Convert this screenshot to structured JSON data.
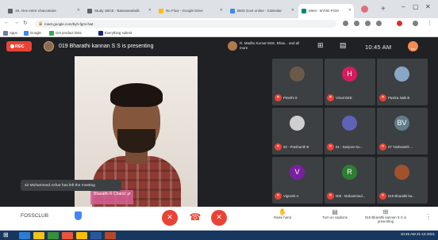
{
  "browser": {
    "tabs": [
      {
        "title": "19, Alex entre chancelaire"
      },
      {
        "title": "Study 1BCE - Basavanahalli"
      },
      {
        "title": "No Flow - Google Drive"
      },
      {
        "title": "BMS Govt online - Calendar"
      },
      {
        "title": "Meet - BYHE-FGM"
      }
    ],
    "address": "meet.google.com/byh-fgmi-hwt",
    "bookmarks": [
      "Apps",
      "Google",
      "Get product hints",
      "Everything submit"
    ]
  },
  "meet": {
    "rec_label": "REC",
    "presenting_text": "019 Bharathi kannan S S is presenting",
    "pinned_text": "R. Madhu Kumar EEE, Bhas... and all more",
    "clock": "10:45 AM",
    "you_label": "You",
    "main_tile_label": "Bharathi R Chand .yr",
    "toast": "42 Mohammed Azhar has left the meeting",
    "participants": [
      {
        "name": "Preethi S",
        "initial": "",
        "color": "#6b5a48"
      },
      {
        "name": "Vinod EEE",
        "initial": "H",
        "color": "#d81b60"
      },
      {
        "name": "Pavitra Naik B",
        "initial": "",
        "color": "#8aa6c8"
      },
      {
        "name": "02 - Prashanth B",
        "initial": "",
        "color": "#cfcfcf"
      },
      {
        "name": "01 - Sanjeev Ku...",
        "initial": "",
        "color": "#5f63b6"
      },
      {
        "name": "07 Yashwanth ...",
        "initial": "BV",
        "color": "#607d8b"
      },
      {
        "name": "Vignesh A",
        "initial": "V",
        "color": "#7b1fa2"
      },
      {
        "name": "006 - Mohammed...",
        "initial": "R",
        "color": "#2e7d32"
      },
      {
        "name": "019 Bharathi ka...",
        "initial": "",
        "color": "#a0522d"
      }
    ],
    "meeting_code": "FOSSCLUB",
    "controls": {
      "mic_icon": "✕",
      "hangup_icon": "☎",
      "cam_icon": "✕"
    },
    "right_buttons": [
      {
        "icon": "✋",
        "label": "Raise hand"
      },
      {
        "icon": "▤",
        "label": "Turn on captions"
      },
      {
        "icon": "⊞",
        "label": "019 Bharathi kannan S S is presenting"
      }
    ]
  },
  "taskbar": {
    "time": "10:45 AM",
    "date": "21-12-2021"
  }
}
